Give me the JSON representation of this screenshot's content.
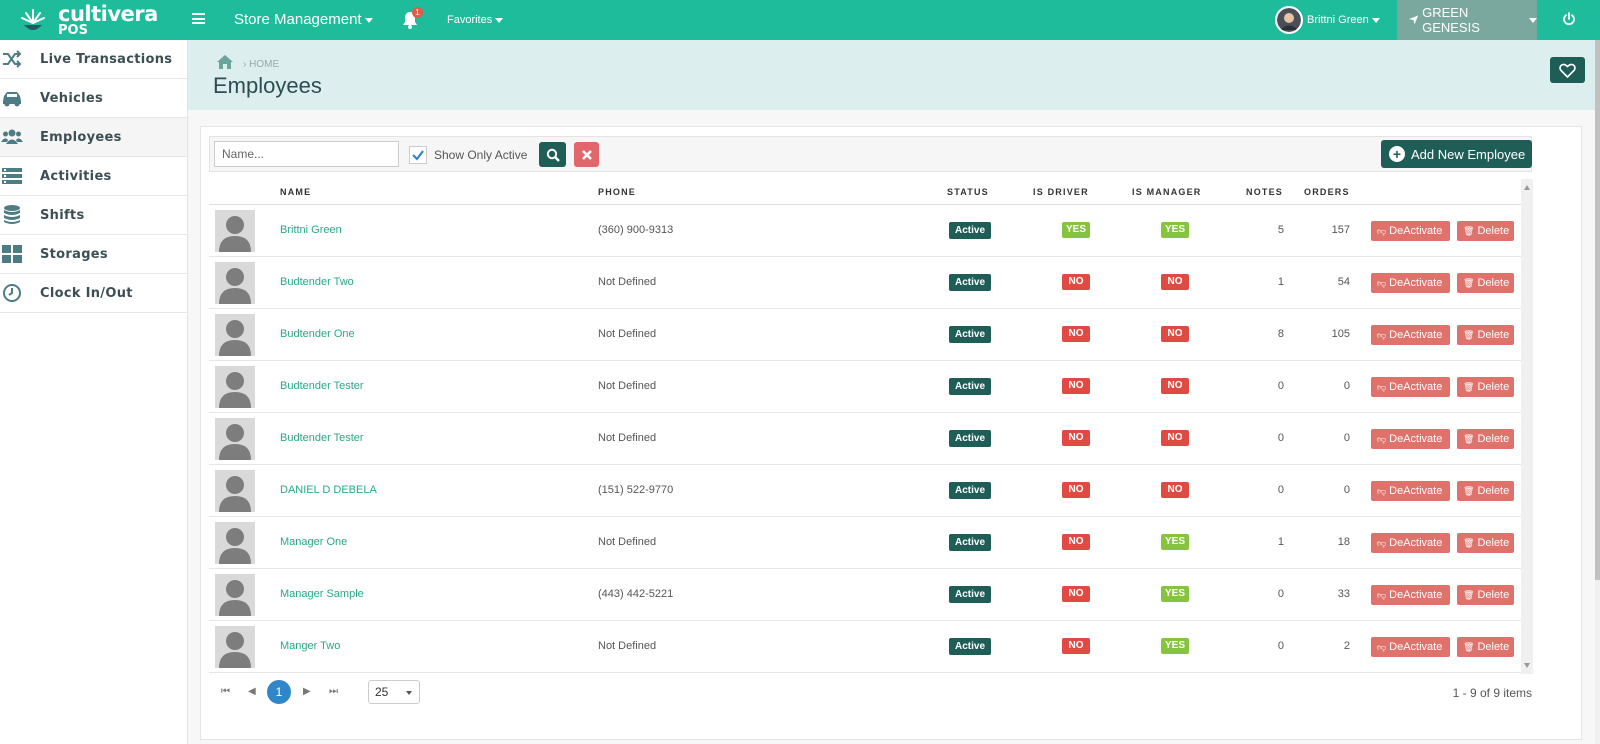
{
  "app": {
    "logo_name": "cultivera",
    "logo_sub": "POS",
    "colors": {
      "brand": "#1fbc9c",
      "dark": "#1f5e57",
      "danger": "#df4b42",
      "success": "#86c440"
    }
  },
  "topbar": {
    "menu_label": "Store Management",
    "notification_count": "1",
    "favorites_label": "Favorites",
    "user_name": "Brittni Green",
    "store_name": "GREEN GENESIS"
  },
  "sidebar": {
    "items": [
      {
        "label": "Live Transactions",
        "icon": "shuffle-icon"
      },
      {
        "label": "Vehicles",
        "icon": "car-icon"
      },
      {
        "label": "Employees",
        "icon": "users-icon"
      },
      {
        "label": "Activities",
        "icon": "list-icon"
      },
      {
        "label": "Shifts",
        "icon": "database-icon"
      },
      {
        "label": "Storages",
        "icon": "grid-icon"
      },
      {
        "label": "Clock In/Out",
        "icon": "clock-icon"
      }
    ]
  },
  "page": {
    "breadcrumb": "HOME",
    "title": "Employees"
  },
  "toolbar": {
    "name_placeholder": "Name...",
    "show_only_active_label": "Show Only Active",
    "show_only_active_checked": true,
    "add_label": "Add New Employee"
  },
  "table": {
    "headers": {
      "name": "NAME",
      "phone": "PHONE",
      "status": "STATUS",
      "is_driver": "IS DRIVER",
      "is_manager": "IS MANAGER",
      "notes": "NOTES",
      "orders": "ORDERS"
    },
    "deactivate_label": "DeActivate",
    "delete_label": "Delete",
    "rows": [
      {
        "name": "Brittni Green",
        "phone": "(360) 900-9313",
        "status": "Active",
        "is_driver": "YES",
        "is_manager": "YES",
        "notes": "5",
        "orders": "157"
      },
      {
        "name": "Budtender Two",
        "phone": "Not Defined",
        "status": "Active",
        "is_driver": "NO",
        "is_manager": "NO",
        "notes": "1",
        "orders": "54"
      },
      {
        "name": "Budtender One",
        "phone": "Not Defined",
        "status": "Active",
        "is_driver": "NO",
        "is_manager": "NO",
        "notes": "8",
        "orders": "105"
      },
      {
        "name": "Budtender Tester",
        "phone": "Not Defined",
        "status": "Active",
        "is_driver": "NO",
        "is_manager": "NO",
        "notes": "0",
        "orders": "0"
      },
      {
        "name": "Budtender Tester",
        "phone": "Not Defined",
        "status": "Active",
        "is_driver": "NO",
        "is_manager": "NO",
        "notes": "0",
        "orders": "0"
      },
      {
        "name": "DANIEL D DEBELA",
        "phone": "(151) 522-9770",
        "status": "Active",
        "is_driver": "NO",
        "is_manager": "NO",
        "notes": "0",
        "orders": "0"
      },
      {
        "name": "Manager One",
        "phone": "Not Defined",
        "status": "Active",
        "is_driver": "NO",
        "is_manager": "YES",
        "notes": "1",
        "orders": "18"
      },
      {
        "name": "Manager Sample",
        "phone": "(443) 442-5221",
        "status": "Active",
        "is_driver": "NO",
        "is_manager": "YES",
        "notes": "0",
        "orders": "33"
      },
      {
        "name": "Manger Two",
        "phone": "Not Defined",
        "status": "Active",
        "is_driver": "NO",
        "is_manager": "YES",
        "notes": "0",
        "orders": "2"
      }
    ]
  },
  "pager": {
    "current_page": "1",
    "page_size": "25",
    "info": "1 - 9 of 9 items"
  }
}
